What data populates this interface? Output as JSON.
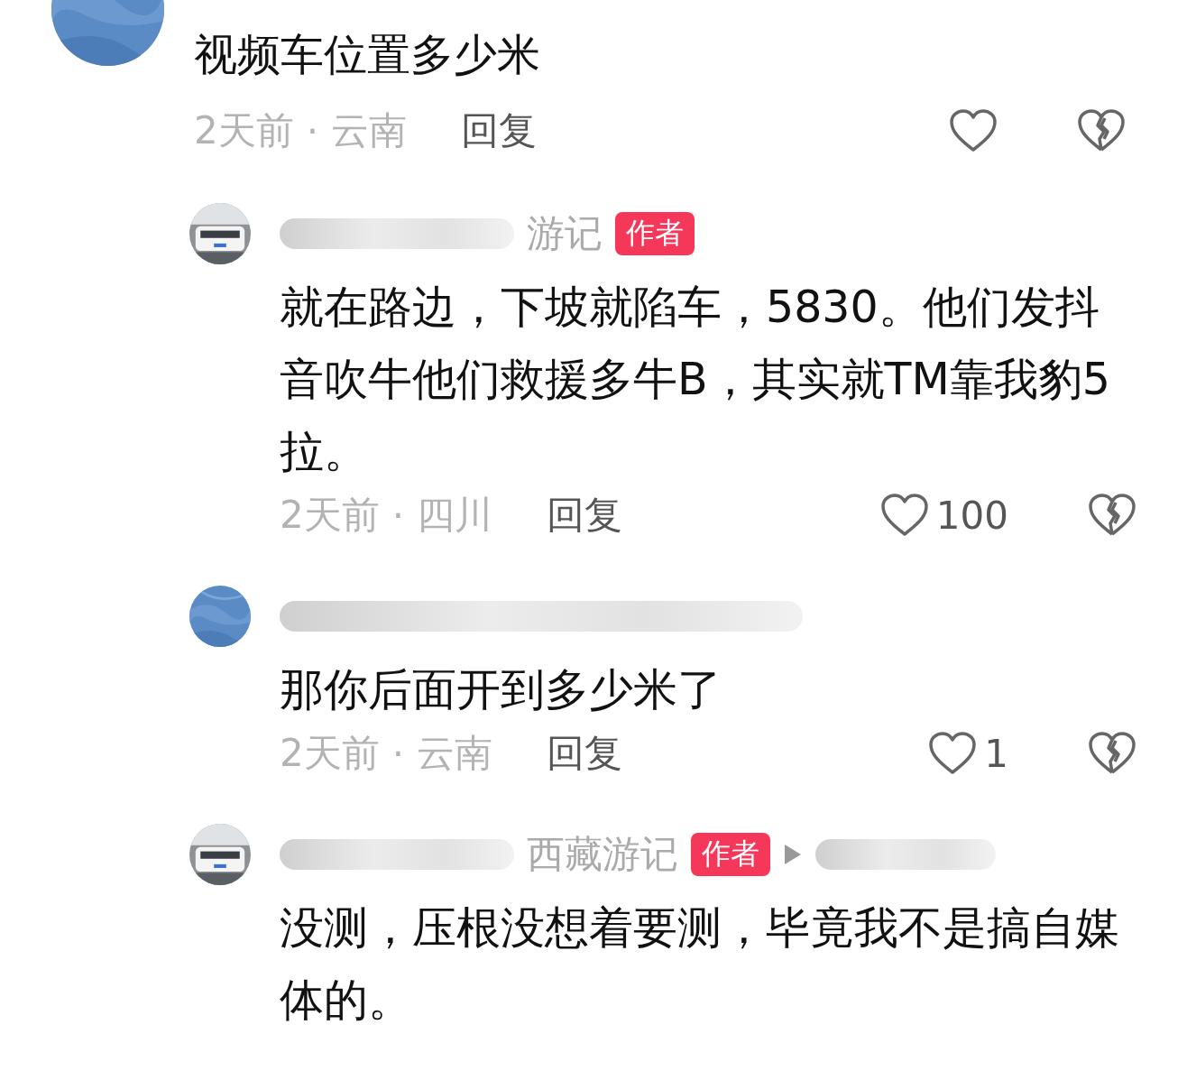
{
  "comment": {
    "text": "视频车位置多少米",
    "time": "2天前",
    "separator": "·",
    "location": "云南",
    "reply_label": "回复"
  },
  "replies": [
    {
      "author": {
        "redacted": true,
        "name": "游记"
      },
      "badge": "作者",
      "text": "就在路边，下坡就陷车，5830。他们发抖音吹牛他们救援多牛B，其实就TM靠我豹5拉。",
      "time": "2天前",
      "separator": "·",
      "location": "四川",
      "reply_label": "回复",
      "likes": "100"
    },
    {
      "author": {
        "redacted": true
      },
      "text": "那你后面开到多少米了",
      "time": "2天前",
      "separator": "·",
      "location": "云南",
      "reply_label": "回复",
      "likes": "1"
    },
    {
      "author": {
        "redacted": true,
        "name": "西藏游记"
      },
      "badge": "作者",
      "reply_to": {
        "redacted": true
      },
      "text": "没测，压根没想着要测，毕竟我不是搞自媒体的。"
    }
  ]
}
